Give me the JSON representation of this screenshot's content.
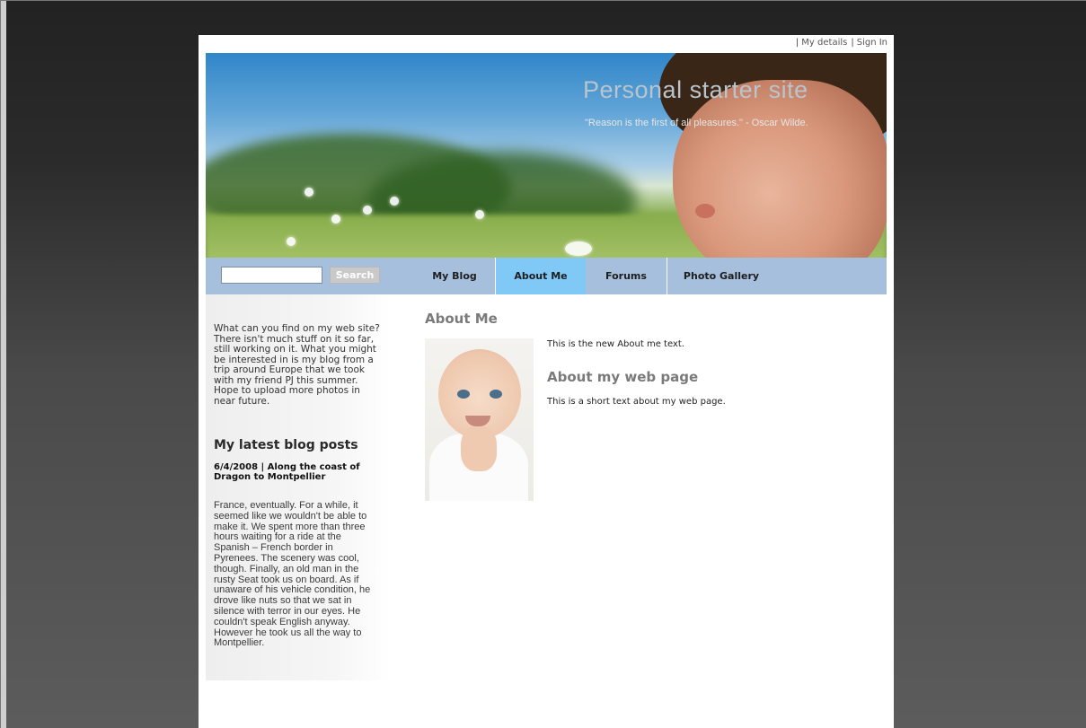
{
  "top_links": {
    "my_details": "My details",
    "sign_in": "Sign In"
  },
  "header": {
    "title": "Personal starter site",
    "quote": "\"Reason is the first of all pleasures.\" - Oscar Wilde."
  },
  "search": {
    "value": "",
    "button_label": "Search"
  },
  "nav": {
    "tabs": [
      {
        "label": "My Blog",
        "active": false
      },
      {
        "label": "About Me",
        "active": true
      },
      {
        "label": "Forums",
        "active": false
      },
      {
        "label": "Photo Gallery",
        "active": false
      }
    ],
    "active_color": "#80c8f5",
    "bar_color": "#a6bfdc"
  },
  "sidebar": {
    "intro": "What can you find on my web site? There isn't much stuff on it so far, still working on it. What you might be interested in is my blog from a trip around Europe that we took with my friend PJ this summer. Hope to upload more photos in near future.",
    "heading": "My latest blog posts",
    "post": {
      "title": "6/4/2008 | Along the coast of Dragon to Montpellier",
      "body": "France, eventually. For a while, it seemed like we wouldn't be able to make it. We spent more than three hours waiting for a ride at the Spanish – French border in Pyrenees. The scenery was cool, though.  Finally, an old man in the rusty Seat took us on board. As if unaware of his vehicle condition, he drove like nuts so that we sat in silence with terror in our eyes. He couldn't speak English anyway. However he took us all the way to Montpellier."
    }
  },
  "main": {
    "heading": "About Me",
    "text1": "This is the new About me text.",
    "subheading": "About my web page",
    "text2": "This is a short text about my web page."
  }
}
